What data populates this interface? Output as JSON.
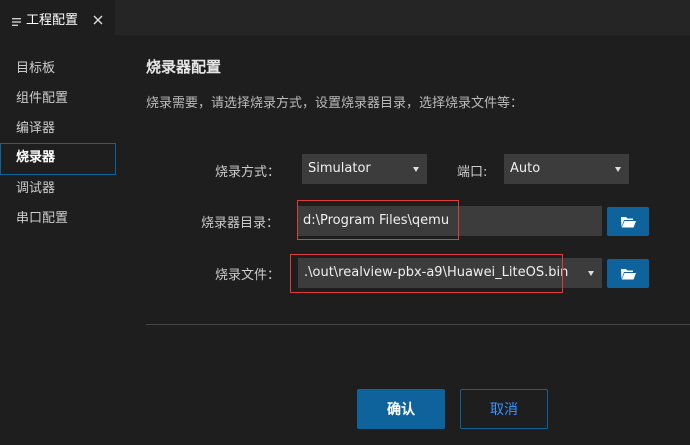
{
  "tab": {
    "icon": "menu-lines-icon",
    "title": "工程配置",
    "close_icon": "close-icon"
  },
  "sidebar": {
    "items": [
      {
        "label": "目标板",
        "active": false
      },
      {
        "label": "组件配置",
        "active": false
      },
      {
        "label": "编译器",
        "active": false
      },
      {
        "label": "烧录器",
        "active": true
      },
      {
        "label": "调试器",
        "active": false
      },
      {
        "label": "串口配置",
        "active": false
      }
    ]
  },
  "section": {
    "title": "烧录器配置",
    "description": "烧录需要，请选择烧录方式，设置烧录器目录，选择烧录文件等："
  },
  "form": {
    "burn_method_label": "烧录方式：",
    "burn_method_value": "Simulator",
    "port_label": "端口:",
    "port_value": "Auto",
    "burner_dir_label": "烧录器目录：",
    "burner_dir_value": "d:\\Program Files\\qemu",
    "burn_file_label": "烧录文件：",
    "burn_file_value": ".\\out\\realview-pbx-a9\\Huawei_LiteOS.bin",
    "folder_icon": "folder-open-icon"
  },
  "buttons": {
    "confirm": "确认",
    "cancel": "取消"
  },
  "colors": {
    "accent": "#0e639c",
    "highlight": "#e23b3b",
    "background": "#1e1e1e"
  }
}
